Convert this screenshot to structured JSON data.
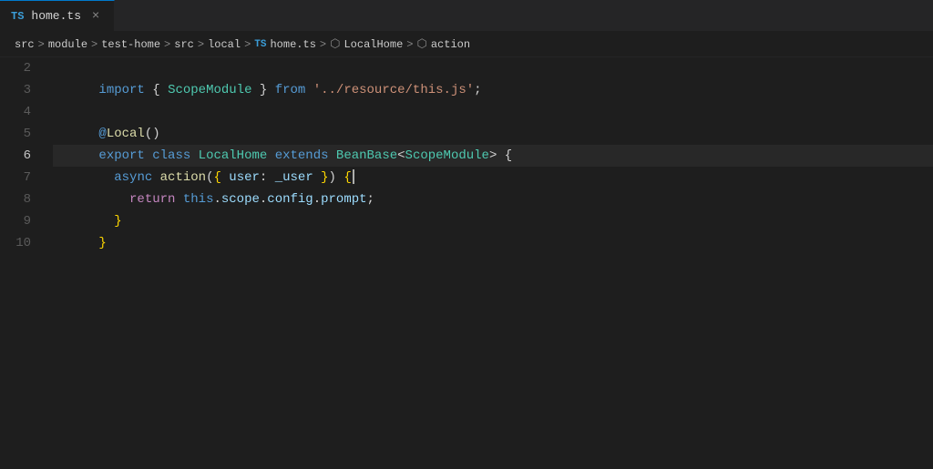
{
  "tab": {
    "ts_label": "TS",
    "filename": "home.ts",
    "close_icon": "×"
  },
  "breadcrumb": {
    "items": [
      {
        "label": "src",
        "type": "text"
      },
      {
        "label": "module",
        "type": "text"
      },
      {
        "label": "test-home",
        "type": "text"
      },
      {
        "label": "src",
        "type": "text"
      },
      {
        "label": "local",
        "type": "text"
      },
      {
        "label": "home.ts",
        "type": "ts"
      },
      {
        "label": "LocalHome",
        "type": "class"
      },
      {
        "label": "action",
        "type": "method"
      }
    ],
    "separators": ">"
  },
  "lines": [
    {
      "num": "2",
      "content": "import { ScopeModule } from '../resource/this.js';"
    },
    {
      "num": "3",
      "content": ""
    },
    {
      "num": "4",
      "content": "@Local()"
    },
    {
      "num": "5",
      "content": "export class LocalHome extends BeanBase<ScopeModule> {"
    },
    {
      "num": "6",
      "content": "  async action({ user: _user }) {"
    },
    {
      "num": "7",
      "content": "    return this.scope.config.prompt;"
    },
    {
      "num": "8",
      "content": "  }"
    },
    {
      "num": "9",
      "content": "}"
    },
    {
      "num": "10",
      "content": ""
    }
  ],
  "colors": {
    "background": "#1e1e1e",
    "tab_active_border": "#007acc",
    "cursor": "#aeafad"
  }
}
